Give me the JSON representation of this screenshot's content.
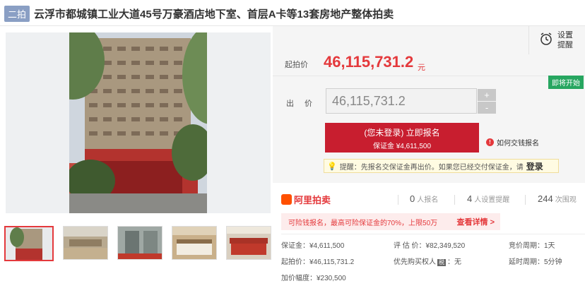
{
  "title": {
    "round_tag": "二拍",
    "text": "云浮市都城镇工业大道45号万豪酒店地下室、首层A卡等13套房地产整体拍卖"
  },
  "reminder": {
    "label_line1": "设置",
    "label_line2": "提醒",
    "icon": "alarm-clock-icon"
  },
  "pricing": {
    "start_label": "起拍价",
    "start_value": "46,115,731.2",
    "start_unit": "元",
    "status_badge": "即将开始",
    "bid_label": "出 价",
    "bid_value": "46,115,731.2",
    "plus": "+",
    "minus": "-"
  },
  "signup": {
    "main_label": "(您未登录) 立即报名",
    "deposit_label": "保证金 ¥4,611,500",
    "how_link": "如何交钱报名"
  },
  "tip": {
    "text": "提醒：先报名交保证金再出价。如果您已经交付保证金，请",
    "login": "登录"
  },
  "stats": {
    "brand": "阿里拍卖",
    "signups_num": "0",
    "signups_label": "人报名",
    "reminders_num": "4",
    "reminders_label": "人设置提醒",
    "views_num": "244",
    "views_label": "次围观"
  },
  "promo": {
    "text": "可险钱报名，最高可险保证金的70%，上限50万",
    "link": "查看详情 >"
  },
  "details": {
    "deposit": "保证金：¥4,611,500",
    "appraisal": "评 估 价：¥82,349,520",
    "cycle": "竞价周期：1天",
    "start_price": "起拍价：¥46,115,731.2",
    "priority_prefix": "优先购买权人",
    "priority_badge": "税",
    "priority_suffix": "：无",
    "delay": "延时周期：5分钟",
    "increment": "加价幅度：¥230,500"
  },
  "colors": {
    "accent_red": "#e4393c",
    "button_red": "#c81e2f",
    "badge_green": "#27a660",
    "tag_blue": "#8a9fc4"
  }
}
